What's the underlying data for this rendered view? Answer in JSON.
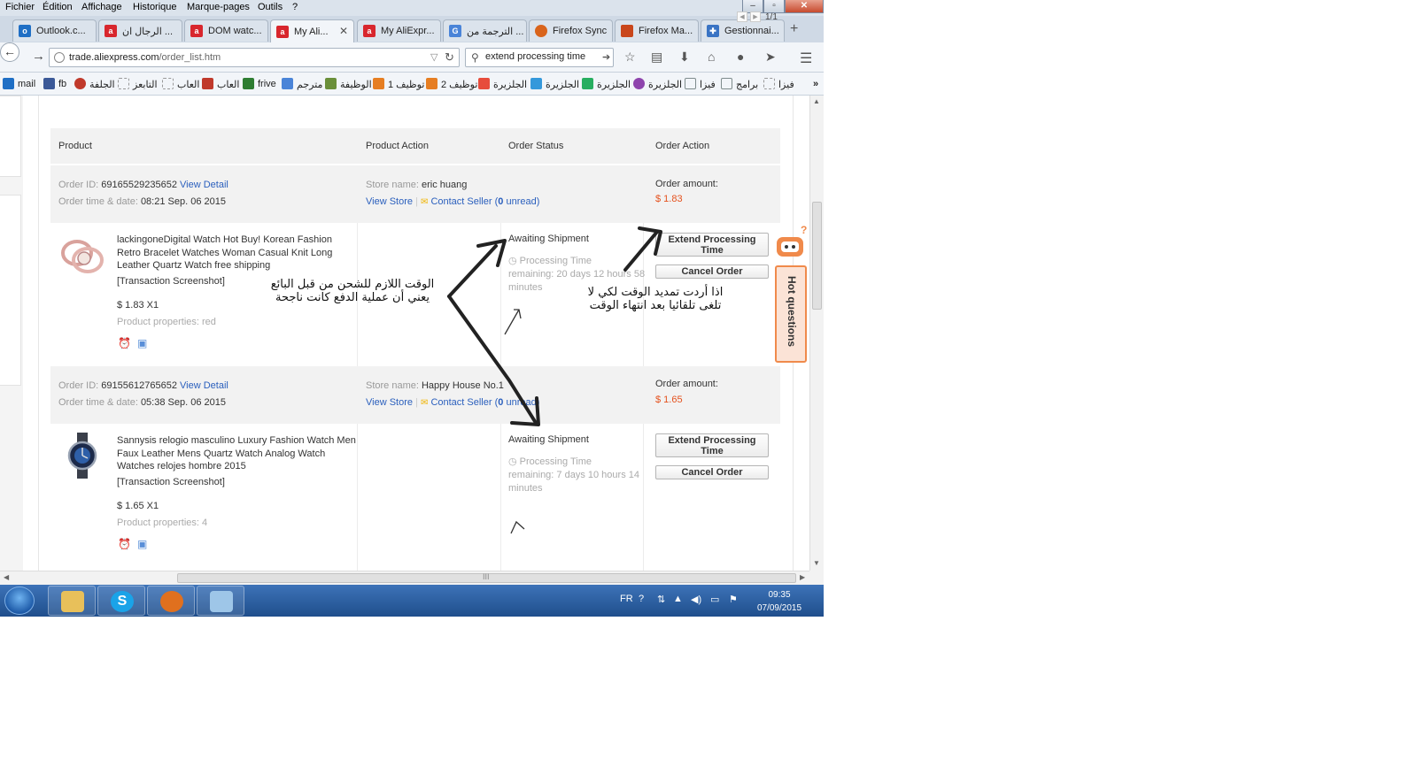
{
  "menubar": {
    "items": [
      "Fichier",
      "Édition",
      "Affichage",
      "Historique",
      "Marque-pages",
      "Outils",
      "?"
    ]
  },
  "tabs": [
    {
      "label": "Outlook.c...",
      "icon": "outlook-icon",
      "color": "#1f6fc5"
    },
    {
      "label": "الرجال ان ...",
      "icon": "aliexpress-icon",
      "color": "#d8262d"
    },
    {
      "label": "DOM watc...",
      "icon": "aliexpress-icon",
      "color": "#d8262d"
    },
    {
      "label": "My Ali...",
      "icon": "aliexpress-icon",
      "color": "#d8262d",
      "active": true
    },
    {
      "label": "My AliExpr...",
      "icon": "aliexpress-icon",
      "color": "#d8262d"
    },
    {
      "label": "الترجمة من ...",
      "icon": "translate-icon",
      "color": "#4a84d8"
    },
    {
      "label": "Firefox Sync",
      "icon": "firefox-icon",
      "color": "#d9641c"
    },
    {
      "label": "Firefox Ma...",
      "icon": "firefox-marketplace-icon",
      "color": "#c9461b"
    },
    {
      "label": "Gestionnai...",
      "icon": "puzzle-icon",
      "color": "#3a74c4"
    }
  ],
  "nav": {
    "url_domain": "trade.aliexpress.com",
    "url_path": "/order_list.htm",
    "search_value": "extend processing time"
  },
  "bookmarks": [
    {
      "label": "mail",
      "color": "#1f6fc5"
    },
    {
      "label": "fb",
      "color": "#3b5998"
    },
    {
      "label": "الجلفة",
      "color": "#c0392b"
    },
    {
      "label": "التابعز",
      "color": "#999999"
    },
    {
      "label": "العاب",
      "color": "#999999"
    },
    {
      "label": "العاب",
      "color": "#c0392b"
    },
    {
      "label": "frive",
      "color": "#2e7d32"
    },
    {
      "label": "مترجم",
      "color": "#4a84d8"
    },
    {
      "label": "الوظيفة",
      "color": "#6a8f3a"
    },
    {
      "label": "توظيف 1",
      "color": "#e67e22"
    },
    {
      "label": "توظيف 2",
      "color": "#e67e22"
    },
    {
      "label": "الجلزيرة",
      "color": "#e74c3c"
    },
    {
      "label": "الجلزيرة",
      "color": "#3498db"
    },
    {
      "label": "الجلزيرة",
      "color": "#27ae60"
    },
    {
      "label": "الجلزيرة",
      "color": "#8e44ad"
    },
    {
      "label": "فيزا",
      "color": "#7f8c8d"
    },
    {
      "label": "برامج",
      "color": "#7f8c8d"
    },
    {
      "label": "فيزا",
      "color": "#7f8c8d"
    }
  ],
  "pager": {
    "text": "1/1"
  },
  "table_headers": [
    "Product",
    "Product Action",
    "Order Status",
    "Order Action"
  ],
  "labels": {
    "order_id": "Order ID:",
    "order_time": "Order time & date:",
    "view_detail": "View Detail",
    "store_name": "Store name:",
    "view_store": "View Store",
    "contact_seller": "Contact Seller",
    "order_amount": "Order amount:",
    "transaction_screenshot": "[Transaction Screenshot]",
    "processing_time": "Processing Time",
    "extend_btn": "Extend Processing Time",
    "cancel_btn": "Cancel Order"
  },
  "orders": [
    {
      "id": "69165529235652",
      "time": "08:21 Sep. 06 2015",
      "store": "eric huang",
      "unread_count": "0",
      "unread_word": "unread",
      "amount": "$ 1.83",
      "product_title": "lackingoneDigital Watch Hot Buy! Korean Fashion Retro Bracelet Watches Woman Casual Knit Long Leather Quartz Watch free shipping",
      "price_qty": "$ 1.83 X1",
      "properties": "Product properties: red",
      "status": "Awaiting Shipment",
      "remaining": "remaining: 20 days 12 hours 58 minutes"
    },
    {
      "id": "69155612765652",
      "time": "05:38 Sep. 06 2015",
      "store": "Happy House No.1",
      "unread_count": "0",
      "unread_word": "unread",
      "amount": "$ 1.65",
      "product_title": "Sannysis relogio masculino Luxury Fashion Watch Men Faux Leather Mens Quartz Watch Analog Watch Watches relojes hombre 2015",
      "price_qty": "$ 1.65 X1",
      "properties": "Product properties: 4",
      "status": "Awaiting Shipment",
      "remaining": "remaining: 7 days 10 hours 14 minutes"
    }
  ],
  "hot_questions": "Hot questions",
  "annotations": {
    "note_left_line1": "الوقت اللازم للشحن من قبل البائع",
    "note_left_line2": "يعني أن عملية الدفع كانت ناجحة",
    "note_right_line1": "اذا أردت تمديد الوقت لكي لا",
    "note_right_line2": "تلغى تلقائيا بعد انتهاء الوقت"
  },
  "taskbar": {
    "lang": "FR",
    "time": "09:35",
    "date": "07/09/2015"
  }
}
